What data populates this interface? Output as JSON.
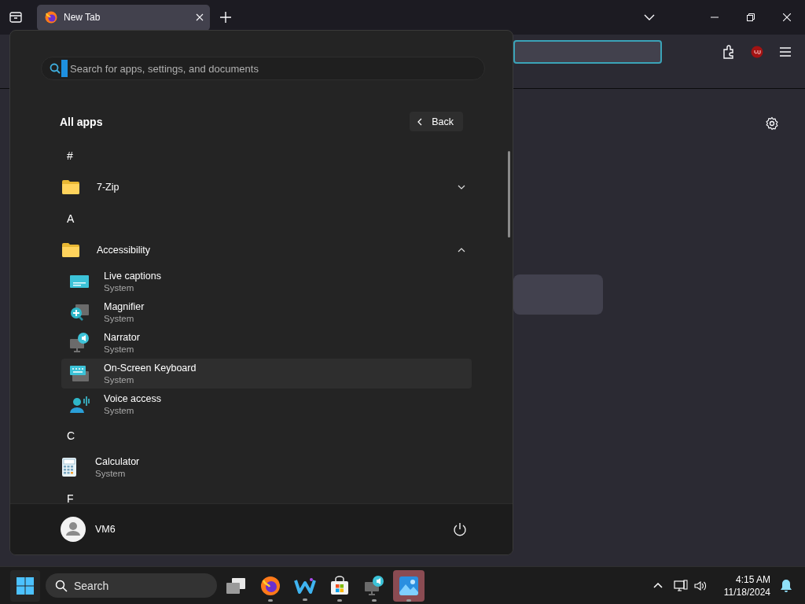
{
  "browser": {
    "tabs": [
      {
        "label": "New Tab",
        "selected": true
      }
    ]
  },
  "start_menu": {
    "search": {
      "placeholder": "Search for apps, settings, and documents"
    },
    "heading": "All apps",
    "back_button": "Back",
    "groups": [
      {
        "letter": "#",
        "items": [
          {
            "kind": "folder",
            "name": "7-Zip",
            "expanded": false
          }
        ]
      },
      {
        "letter": "A",
        "items": [
          {
            "kind": "folder",
            "name": "Accessibility",
            "expanded": true,
            "children": [
              {
                "kind": "captions",
                "name": "Live captions",
                "subtitle": "System",
                "selected": false
              },
              {
                "kind": "magnifier",
                "name": "Magnifier",
                "subtitle": "System",
                "selected": false
              },
              {
                "kind": "narrator",
                "name": "Narrator",
                "subtitle": "System",
                "selected": false
              },
              {
                "kind": "keyboard",
                "name": "On-Screen Keyboard",
                "subtitle": "System",
                "selected": true
              },
              {
                "kind": "voice",
                "name": "Voice access",
                "subtitle": "System",
                "selected": false
              }
            ]
          }
        ]
      },
      {
        "letter": "C",
        "items": [
          {
            "kind": "calculator",
            "name": "Calculator",
            "subtitle": "System"
          }
        ]
      },
      {
        "letter": "F"
      }
    ],
    "user": {
      "name": "VM6"
    }
  },
  "taskbar": {
    "search": {
      "placeholder": "Search"
    },
    "apps": [
      {
        "kind": "task-view",
        "running": false,
        "selected": false
      },
      {
        "kind": "firefox",
        "running": true,
        "selected": false
      },
      {
        "kind": "writer",
        "running": true,
        "selected": false
      },
      {
        "kind": "store",
        "running": true,
        "selected": false
      },
      {
        "kind": "narrator",
        "running": true,
        "selected": false
      },
      {
        "kind": "photos",
        "running": true,
        "selected": true
      }
    ],
    "clock": {
      "time": "4:15 AM",
      "date": "11/18/2024"
    }
  }
}
